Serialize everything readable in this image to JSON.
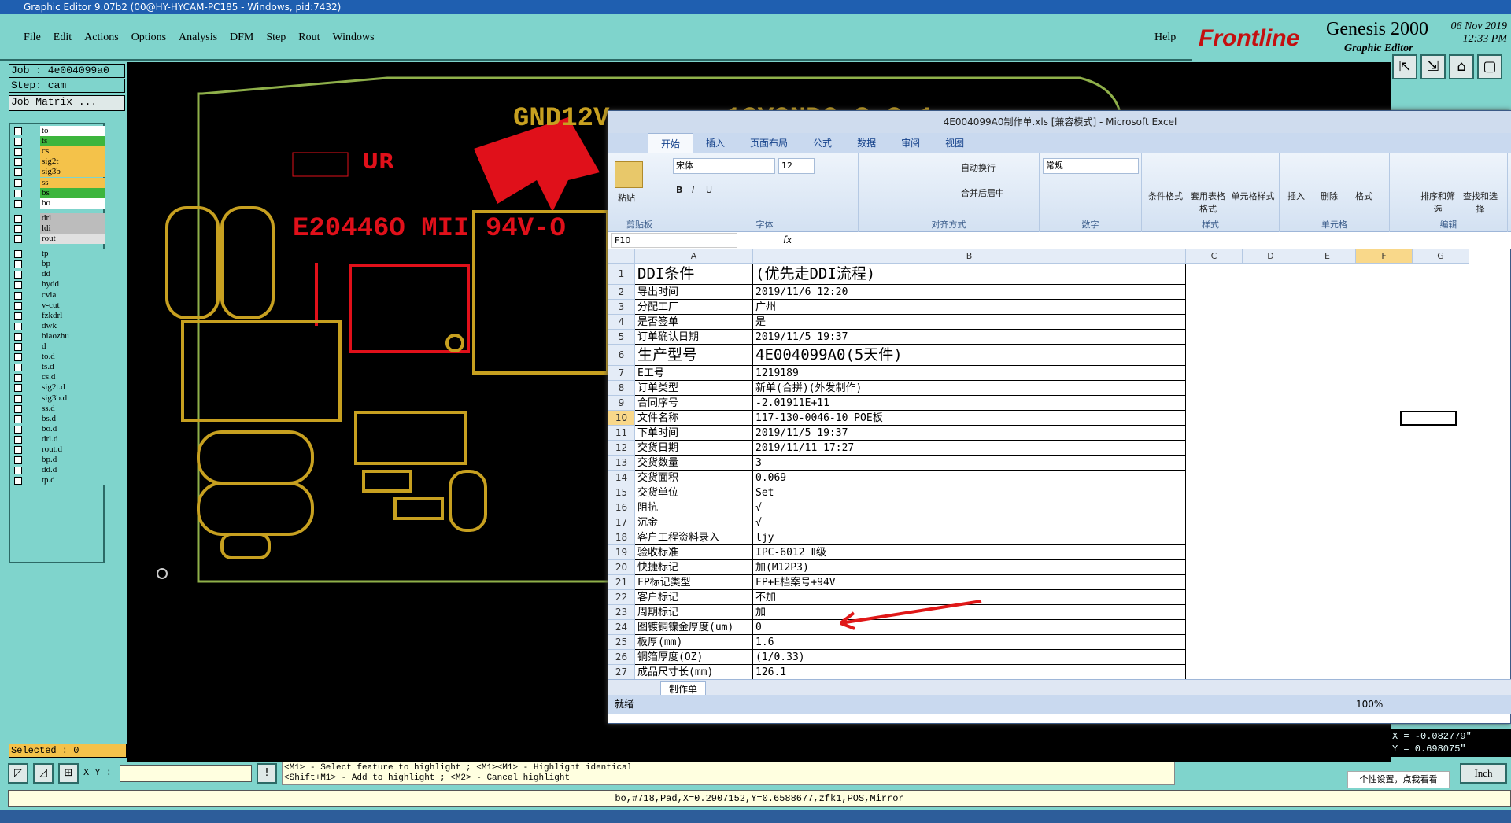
{
  "titlebar": {
    "text": "Graphic Editor 9.07b2 (00@HY-HYCAM-PC185 - Windows, pid:7432)"
  },
  "menu": {
    "items": [
      "File",
      "Edit",
      "Actions",
      "Options",
      "Analysis",
      "DFM",
      "Step",
      "Rout",
      "Windows"
    ],
    "help": "Help"
  },
  "brand": {
    "frontline": "Frontline",
    "genesis": "Genesis 2000",
    "graphic_editor": "Graphic Editor",
    "date": "06 Nov 2019",
    "time": "12:33 PM"
  },
  "info": {
    "job": "Job : 4e004099a0",
    "step": "Step: cam",
    "matrix": "Job Matrix ..."
  },
  "layers": [
    {
      "name": "to",
      "color": "#ffffff"
    },
    {
      "name": "ts",
      "color": "#3db53d"
    },
    {
      "name": "cs",
      "color": "#f4c24a"
    },
    {
      "name": "sig2t",
      "color": "#f4c24a"
    },
    {
      "name": "sig3b",
      "color": "#f4c24a"
    },
    {
      "name": "ss",
      "color": "#f4c24a"
    },
    {
      "name": "bs",
      "color": "#3db53d"
    },
    {
      "name": "bo",
      "color": "#ffffff"
    },
    {
      "name": "drl",
      "color": "#bcbcbc"
    },
    {
      "name": "ldi",
      "color": "#bcbcbc"
    },
    {
      "name": "rout",
      "color": "#e0e0e0"
    },
    {
      "name": "tp",
      "color": "#7fd4cc"
    },
    {
      "name": "bp",
      "color": "#7fd4cc"
    },
    {
      "name": "dd",
      "color": "#7fd4cc"
    },
    {
      "name": "hydd",
      "color": "#7fd4cc"
    },
    {
      "name": "cvia",
      "color": "#7fd4cc"
    },
    {
      "name": "v-cut",
      "color": "#7fd4cc"
    },
    {
      "name": "fzkdrl",
      "color": "#7fd4cc"
    },
    {
      "name": "dwk",
      "color": "#7fd4cc"
    },
    {
      "name": "biaozhu",
      "color": "#7fd4cc"
    },
    {
      "name": "d",
      "color": "#7fd4cc"
    },
    {
      "name": "to.d",
      "color": "#7fd4cc"
    },
    {
      "name": "ts.d",
      "color": "#7fd4cc"
    },
    {
      "name": "cs.d",
      "color": "#7fd4cc"
    },
    {
      "name": "sig2t.d",
      "color": "#7fd4cc"
    },
    {
      "name": "sig3b.d",
      "color": "#7fd4cc"
    },
    {
      "name": "ss.d",
      "color": "#7fd4cc"
    },
    {
      "name": "bs.d",
      "color": "#7fd4cc"
    },
    {
      "name": "bo.d",
      "color": "#7fd4cc"
    },
    {
      "name": "drl.d",
      "color": "#7fd4cc"
    },
    {
      "name": "rout.d",
      "color": "#7fd4cc"
    },
    {
      "name": "bp.d",
      "color": "#7fd4cc"
    },
    {
      "name": "dd.d",
      "color": "#7fd4cc"
    },
    {
      "name": "tp.d",
      "color": "#7fd4cc"
    }
  ],
  "selected": "Selected : 0",
  "pcb": {
    "ul_mark": "UR",
    "text1": "E20446O MII 94V-O",
    "text2": "GND12V",
    "text3": "12VGND6 3 2 1"
  },
  "coords": {
    "x": "X = -0.082779\"",
    "y": "Y = 0.698075\""
  },
  "unit": "Inch",
  "xy_label": "X Y :",
  "message": {
    "line1": "<M1> - Select feature to highlight ; <M1><M1> - Highlight identical",
    "line2": "<Shift+M1> - Add to highlight ; <M2> - Cancel highlight"
  },
  "status_line": "bo,#718,Pad,X=0.2907152,Y=0.6588677,zfk1,POS,Mirror",
  "tooltip": "个性设置，点我看看",
  "excel": {
    "title": "4E004099A0制作单.xls [兼容模式] - Microsoft Excel",
    "tabs": [
      "开始",
      "插入",
      "页面布局",
      "公式",
      "数据",
      "审阅",
      "视图"
    ],
    "ribbon": {
      "font_name": "宋体",
      "font_size": "12",
      "number_fmt": "常规",
      "wrap": "自动换行",
      "merge": "合并后居中",
      "groups": [
        "剪贴板",
        "字体",
        "对齐方式",
        "数字",
        "样式",
        "单元格",
        "编辑"
      ],
      "buttons": [
        "粘贴",
        "条件格式",
        "套用表格格式",
        "单元格样式",
        "插入",
        "删除",
        "格式",
        "排序和筛选",
        "查找和选择"
      ]
    },
    "namebox": "F10",
    "fx": "fx",
    "columns": [
      "A",
      "B",
      "C",
      "D",
      "E",
      "F",
      "G"
    ],
    "rows": [
      {
        "n": "1",
        "a": "DDI条件",
        "b": "(优先走DDI流程)"
      },
      {
        "n": "2",
        "a": "导出时间",
        "b": "2019/11/6 12:20"
      },
      {
        "n": "3",
        "a": "分配工厂",
        "b": "广州"
      },
      {
        "n": "4",
        "a": "是否签单",
        "b": "是"
      },
      {
        "n": "5",
        "a": "订单确认日期",
        "b": "2019/11/5 19:37"
      },
      {
        "n": "6",
        "a": "生产型号",
        "b": "4E004099A0(5天件)"
      },
      {
        "n": "7",
        "a": "E工号",
        "b": "1219189"
      },
      {
        "n": "8",
        "a": "订单类型",
        "b": "新单(合拼)(外发制作)"
      },
      {
        "n": "9",
        "a": "合同序号",
        "b": "-2.01911E+11"
      },
      {
        "n": "10",
        "a": "文件名称",
        "b": "117-130-0046-10 POE板"
      },
      {
        "n": "11",
        "a": "下单时间",
        "b": "2019/11/5 19:37"
      },
      {
        "n": "12",
        "a": "交货日期",
        "b": "2019/11/11 17:27"
      },
      {
        "n": "13",
        "a": "交货数量",
        "b": "3"
      },
      {
        "n": "14",
        "a": "交货面积",
        "b": "0.069"
      },
      {
        "n": "15",
        "a": "交货单位",
        "b": "Set"
      },
      {
        "n": "16",
        "a": "阻抗",
        "b": "√"
      },
      {
        "n": "17",
        "a": "沉金",
        "b": "√"
      },
      {
        "n": "18",
        "a": "客户工程资料录入",
        "b": "ljy"
      },
      {
        "n": "19",
        "a": "验收标准",
        "b": "IPC-6012 Ⅱ级"
      },
      {
        "n": "20",
        "a": "快捷标记",
        "b": "加(M12P3)"
      },
      {
        "n": "21",
        "a": "FP标记类型",
        "b": "FP+E档案号+94V"
      },
      {
        "n": "22",
        "a": "客户标记",
        "b": "不加"
      },
      {
        "n": "23",
        "a": "周期标记",
        "b": "加"
      },
      {
        "n": "24",
        "a": "图镀铜镍金厚度(um)",
        "b": "0"
      },
      {
        "n": "25",
        "a": "板厚(mm)",
        "b": "1.6"
      },
      {
        "n": "26",
        "a": "铜箔厚度(OZ)",
        "b": "(1/0.33)"
      },
      {
        "n": "27",
        "a": "成品尺寸长(mm)",
        "b": "126.1"
      }
    ],
    "sheet_tab": "制作单",
    "status": "就绪",
    "zoom": "100%"
  }
}
